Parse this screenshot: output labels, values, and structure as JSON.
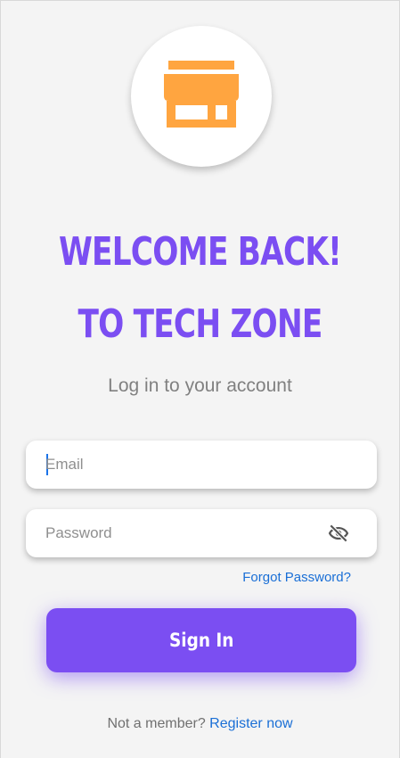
{
  "colors": {
    "accent": "#7b4ef2",
    "logo": "#ffa540",
    "link": "#1a6fd6",
    "background": "#f4f4f4"
  },
  "logo": {
    "icon": "storefront-icon"
  },
  "header": {
    "title_line1": "WELCOME BACK!",
    "title_line2": "TO TECH ZONE",
    "subtitle": "Log in to your account"
  },
  "form": {
    "email_placeholder": "Email",
    "email_value": "",
    "password_placeholder": "Password",
    "password_value": "",
    "password_toggle_icon": "eye-off-icon",
    "forgot_label": "Forgot Password?",
    "signin_label": "Sign In"
  },
  "footer": {
    "prompt": "Not a member?",
    "register_label": "Register now"
  }
}
